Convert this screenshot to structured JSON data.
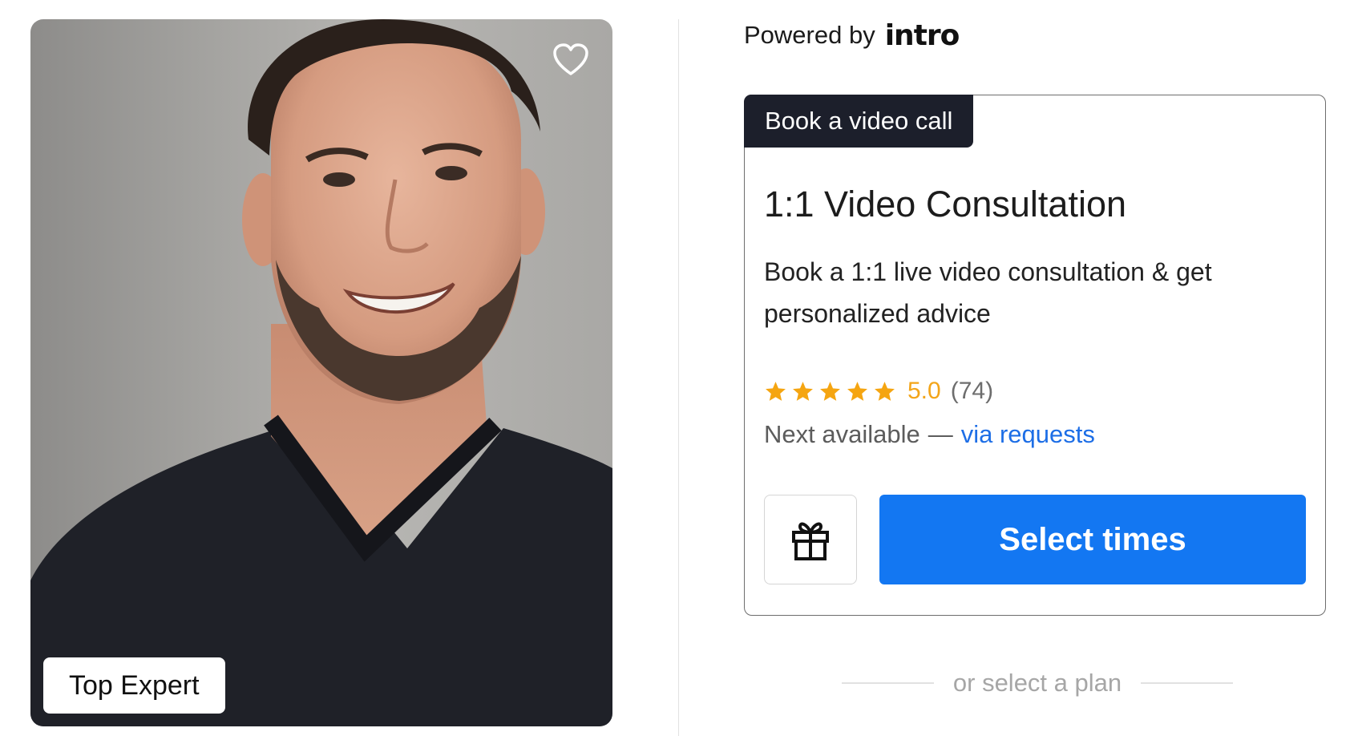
{
  "profile": {
    "badge": "Top Expert",
    "favorite_icon": "heart-outline-icon"
  },
  "powered_by": {
    "label": "Powered by",
    "brand": "intro"
  },
  "offer": {
    "tab_label": "Book a video call",
    "title": "1:1 Video Consultation",
    "description": "Book a 1:1 live video consultation & get personalized advice",
    "rating": {
      "stars": 5,
      "max_stars": 5,
      "value": "5.0",
      "count": "(74)",
      "star_color": "#f5a511"
    },
    "availability": {
      "label": "Next available",
      "dash": "—",
      "link": "via requests"
    },
    "gift_icon": "gift-icon",
    "cta_label": "Select times",
    "cta_color": "#1377f2"
  },
  "plans": {
    "separator_label": "or select a plan"
  }
}
